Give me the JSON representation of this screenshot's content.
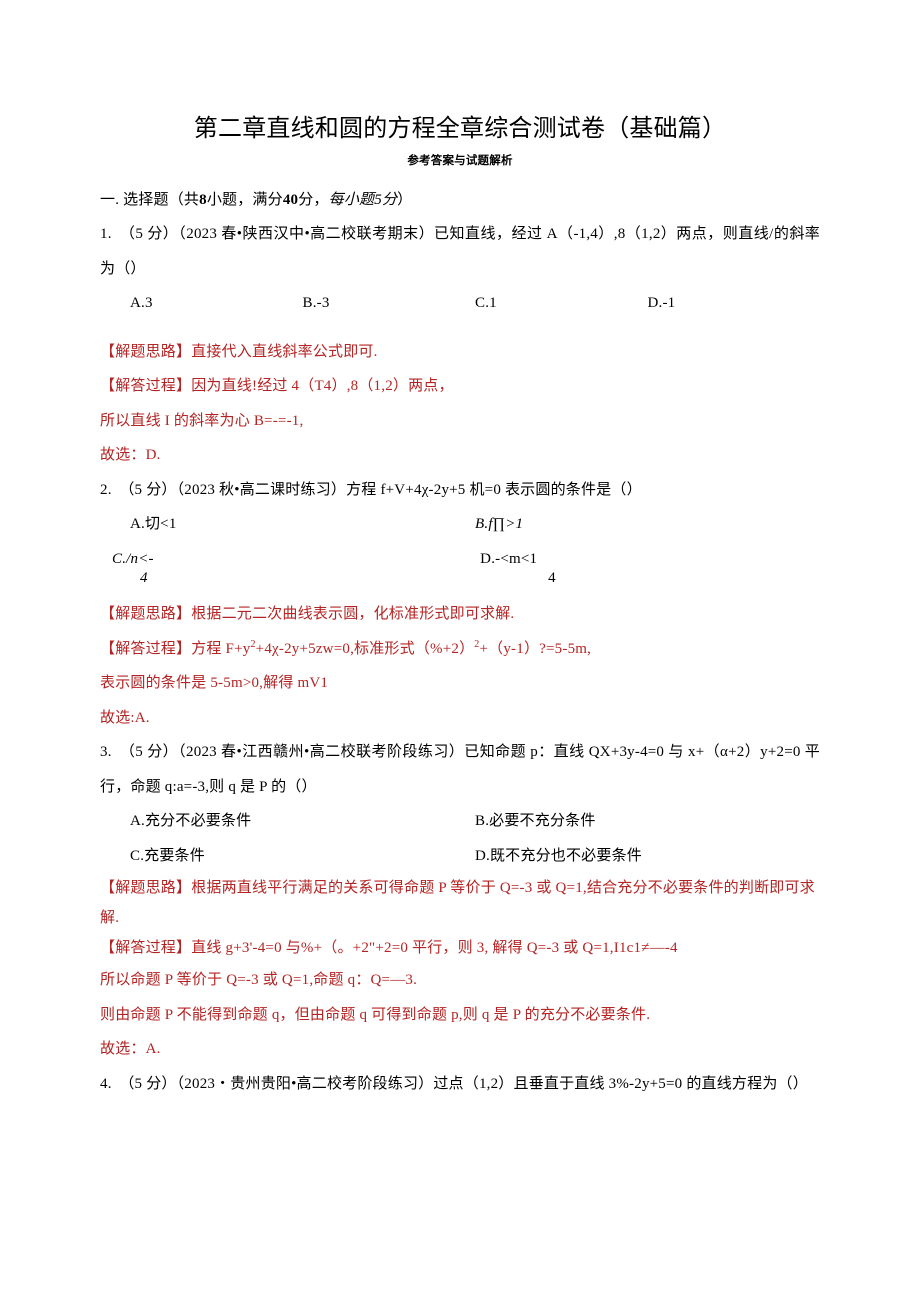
{
  "title": "第二章直线和圆的方程全章综合测试卷（基础篇）",
  "subtitle": "参考答案与试题解析",
  "section1": {
    "heading_pre": "一. 选择题（共",
    "eight": "8",
    "heading_mid": "小题，满分",
    "forty": "40",
    "heading_after": "分，",
    "italic": "每小题5分",
    "heading_end": "）"
  },
  "q1": {
    "stem": "1.　（5 分）（2023 春•陕西汉中•高二校联考期末）已知直线，经过 A（-1,4）,8（1,2）两点，则直线/的斜率为（）",
    "a": "A.3",
    "b": "B.-3",
    "c": "C.1",
    "d": "D.-1",
    "exp1": "【解题思路】直接代入直线斜率公式即可.",
    "exp2": "【解答过程】因为直线!经过 4（T4）,8（1,2）两点，",
    "exp3": "所以直线 I 的斜率为心 B=-=-1,",
    "exp4": "故选：D."
  },
  "q2": {
    "stem": "2.　（5 分）（2023 秋•高二课时练习）方程 f+V+4χ-2y+5 机=0 表示圆的条件是（）",
    "a": "A.切<1",
    "b": "B.f∏>1",
    "c_l1": "C./n<-",
    "c_l2": "4",
    "d_l1": "D.-<m<1",
    "d_l2": "4",
    "exp1": "【解题思路】根据二元二次曲线表示圆，化标准形式即可求解.",
    "exp2_a": "【解答过程】方程 F+y",
    "exp2_b": "+4χ-2y+5zw=0,标准形式（%+2）",
    "exp2_c": "+（y-1）?=5-5m,",
    "exp3": "表示圆的条件是 5-5m>0,解得 mV1",
    "exp4": "故选:A."
  },
  "q3": {
    "stem": "3.　（5 分）（2023 春•江西赣州•高二校联考阶段练习）已知命题 p：直线 QX+3y-4=0 与 x+（α+2）y+2=0 平行，命题 q:a=-3,则 q 是 P 的（）",
    "a": "A.充分不必要条件",
    "b": "B.必要不充分条件",
    "c": "C.充要条件",
    "d": "D.既不充分也不必要条件",
    "exp1": "【解题思路】根据两直线平行满足的关系可得命题 P 等价于 Q=-3 或 Q=1,结合充分不必要条件的判断即可求解.",
    "exp2": "【解答过程】直线 g+3'-4=0 与%+（。+2\"+2=0 平行，则 3, 解得 Q=-3 或 Q=1,I1c1≠—-4",
    "exp3": "所以命题 P 等价于 Q=-3 或 Q=1,命题 q：Q=—3.",
    "exp4": "则由命题 P 不能得到命题 q，但由命题 q 可得到命题 p,则 q 是 P 的充分不必要条件.",
    "exp5": "故选：A."
  },
  "q4": {
    "stem": "4.　（5 分）（2023・贵州贵阳•高二校考阶段练习）过点（1,2）且垂直于直线 3%-2y+5=0 的直线方程为（）"
  }
}
